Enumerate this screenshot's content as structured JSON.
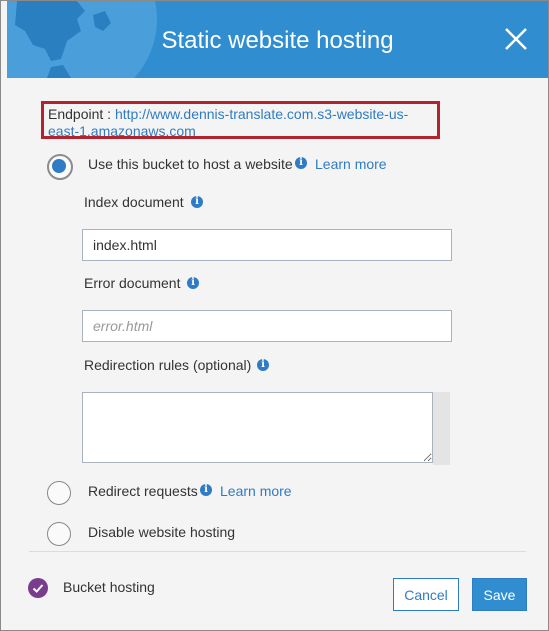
{
  "dialog": {
    "title": "Static website hosting",
    "accent_color": "#2f8dd0",
    "highlight_color": "#b3232d"
  },
  "endpoint": {
    "label": "Endpoint : ",
    "url": "http://www.dennis-translate.com.s3-website-us-east-1.amazonaws.com"
  },
  "options": {
    "host": {
      "label": "Use this bucket to host a website",
      "learn_more": "Learn more",
      "selected": true
    },
    "redirect": {
      "label": "Redirect requests",
      "learn_more": "Learn more",
      "selected": false
    },
    "disable": {
      "label": "Disable website hosting",
      "selected": false
    }
  },
  "fields": {
    "index_label": "Index document",
    "index_value": "index.html",
    "error_label": "Error document",
    "error_placeholder": "error.html",
    "redirection_label": "Redirection rules (optional)"
  },
  "footer": {
    "status_label": "Bucket hosting",
    "cancel_label": "Cancel",
    "save_label": "Save"
  },
  "icons": {
    "info": "info-icon",
    "close": "close-icon",
    "check": "check-circle-icon",
    "globe": "globe-icon"
  }
}
